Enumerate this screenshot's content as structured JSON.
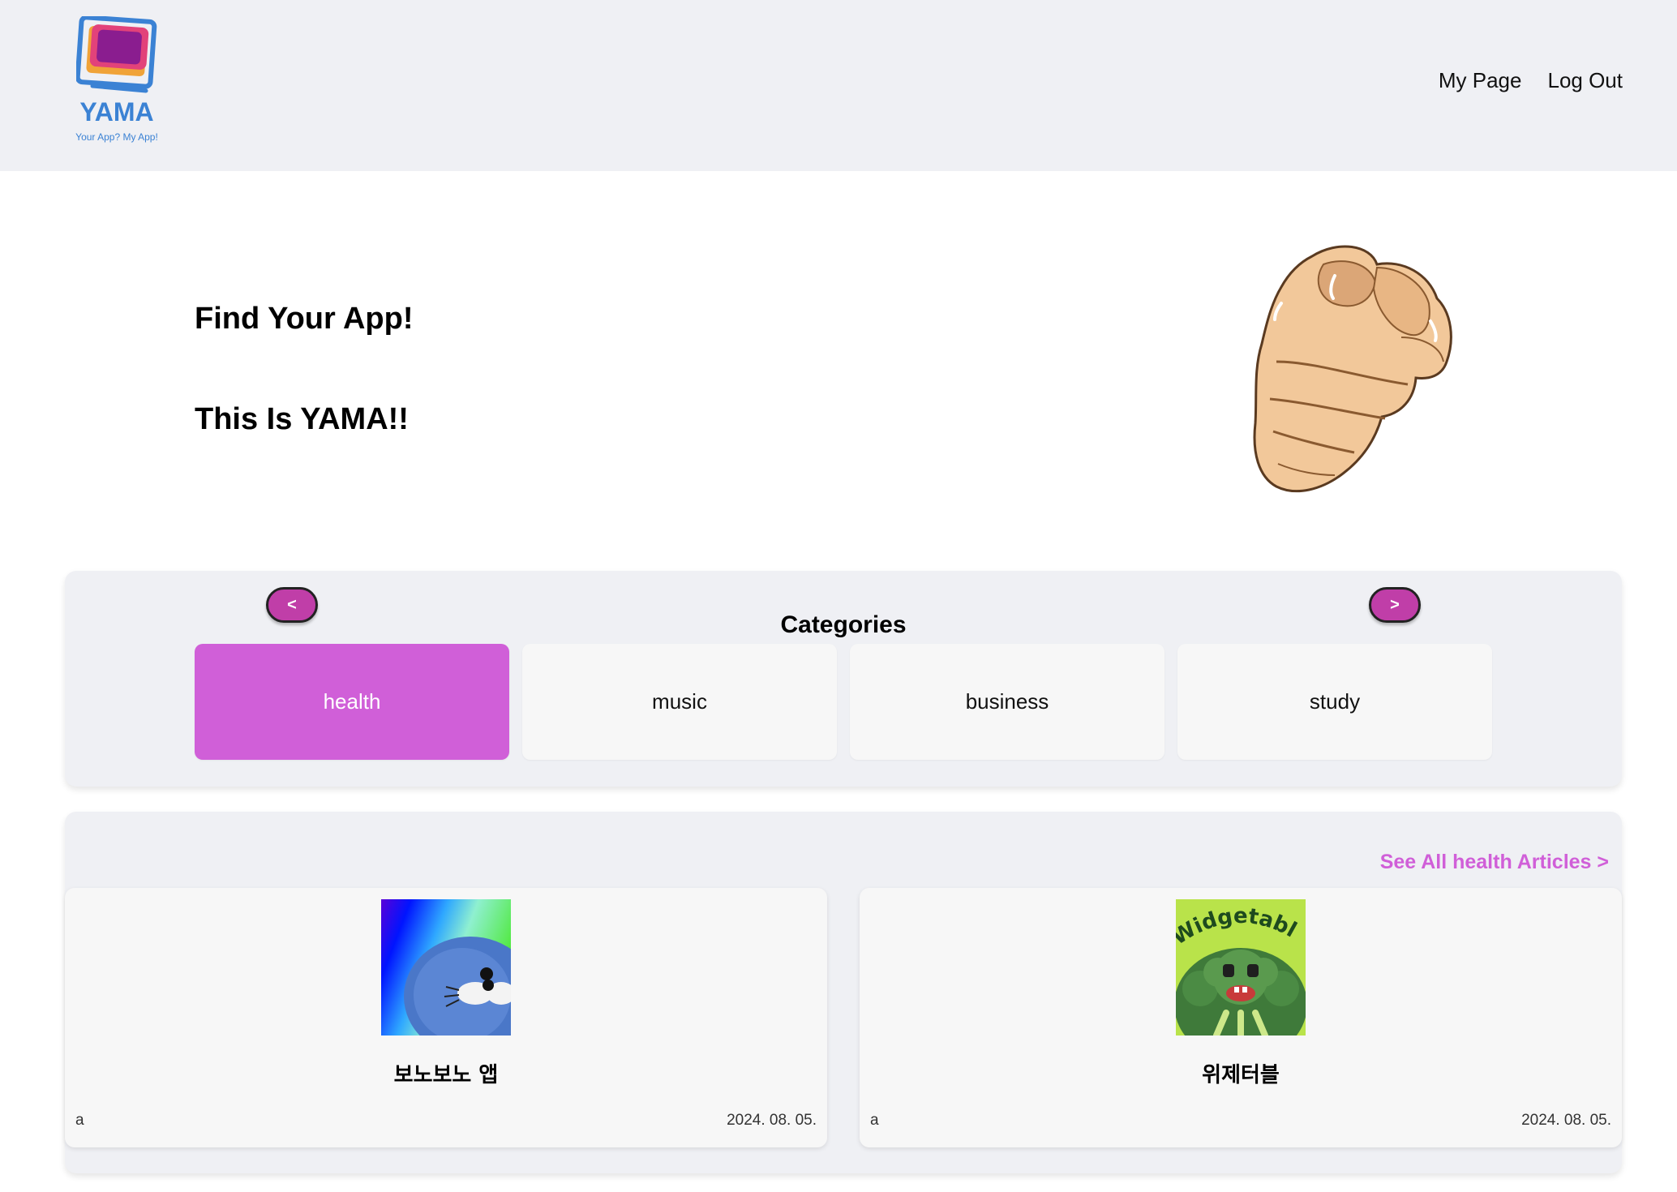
{
  "header": {
    "logo_name": "YAMA",
    "logo_tagline": "Your App? My App!",
    "nav": {
      "my_page": "My Page",
      "log_out": "Log Out"
    }
  },
  "hero": {
    "line1": "Find Your App!",
    "line2": "This Is YAMA!!"
  },
  "categories": {
    "title": "Categories",
    "prev_label": "<",
    "next_label": ">",
    "items": [
      {
        "label": "health",
        "active": true
      },
      {
        "label": "music",
        "active": false
      },
      {
        "label": "business",
        "active": false
      },
      {
        "label": "study",
        "active": false
      }
    ]
  },
  "articles": {
    "see_all": "See All health Articles >",
    "items": [
      {
        "title": "보노보노 앱",
        "author": "a",
        "date": "2024. 08. 05.",
        "thumb_icon": "seal-app-icon"
      },
      {
        "title": "위제터블",
        "author": "a",
        "date": "2024. 08. 05.",
        "thumb_icon": "widgetable-app-icon",
        "thumb_text": "Widgetable"
      }
    ]
  },
  "colors": {
    "accent": "#d05fd8",
    "arrow_button": "#c03ea8",
    "header_bg": "#eff0f4",
    "logo_blue": "#3b82d4"
  }
}
